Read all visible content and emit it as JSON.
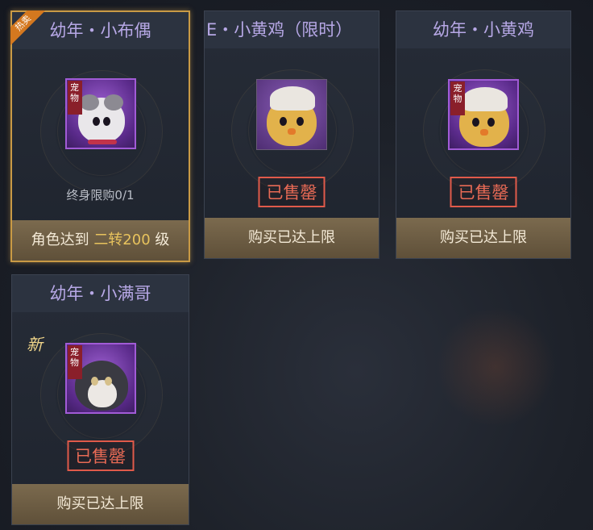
{
  "cards": [
    {
      "title": "幼年・小布偶",
      "ribbon": "热卖",
      "limit_text": "终身限购0/1",
      "footer_prefix": "角色达到 ",
      "footer_highlight": "二转200",
      "footer_suffix": " 级",
      "tag": "宠物",
      "pet_icon": "ragdoll-cat-icon"
    },
    {
      "title": "E・小黄鸡（限时）",
      "sold": "已售罄",
      "footer": "购买已达上限",
      "pet_icon": "yellow-chick-icon"
    },
    {
      "title": "幼年・小黄鸡",
      "sold": "已售罄",
      "footer": "购买已达上限",
      "tag": "宠物",
      "pet_icon": "yellow-chick-icon"
    },
    {
      "title": "幼年・小满哥",
      "new_badge": "新",
      "sold": "已售罄",
      "footer": "购买已达上限",
      "tag": "宠物",
      "pet_icon": "husky-dog-icon"
    }
  ],
  "colors": {
    "title": "#b7a8e6",
    "sold": "#e86a55",
    "highlight_border": "#c99a45",
    "footer_bg": "#6e5d44"
  }
}
